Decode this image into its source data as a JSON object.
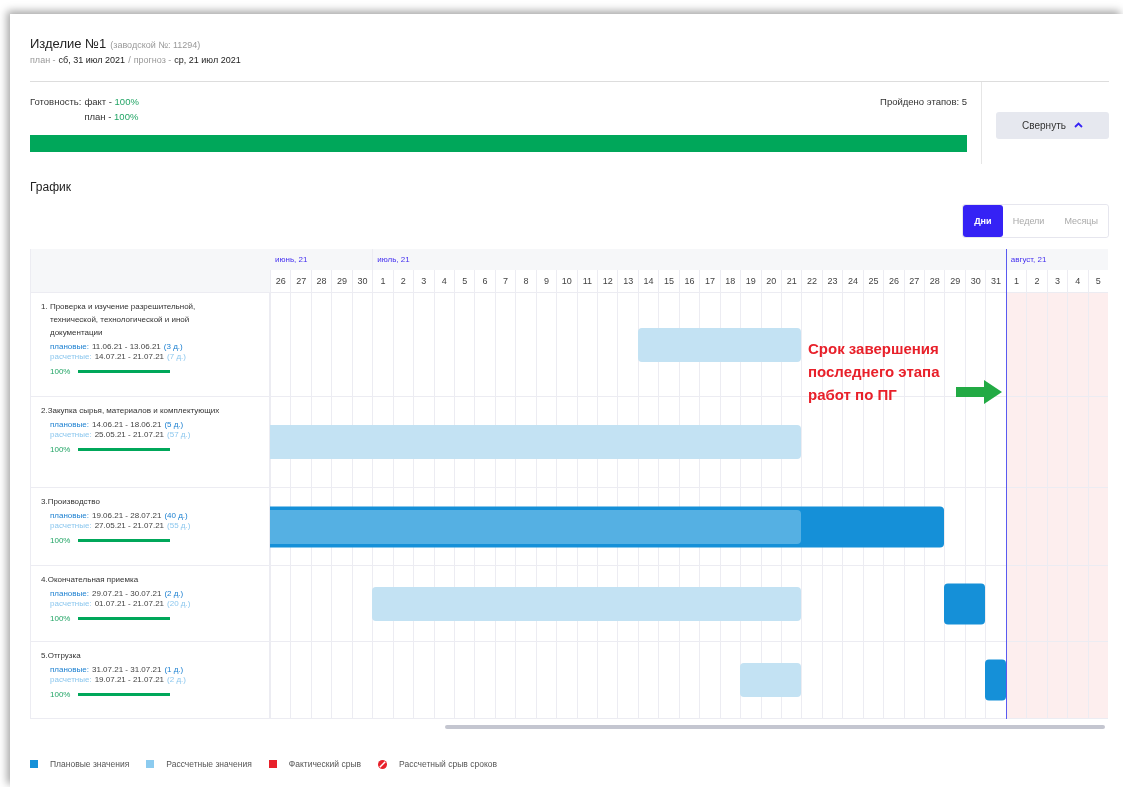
{
  "product": {
    "title": "Изделие №1",
    "serial": "(заводской №: 11294)",
    "plan_label": "план -",
    "plan_date": "сб, 31 июл 2021",
    "separator": "/",
    "forecast_label": "прогноз -",
    "forecast_date": "ср, 21 июл 2021"
  },
  "readiness": {
    "label": "Готовность:",
    "fact_label": "факт -",
    "fact_value": "100%",
    "plan_label": "план -",
    "plan_value": "100%",
    "level": 1,
    "stages_passed": "Пройдено этапов: 5"
  },
  "collapse_button": {
    "label": "Свернуть"
  },
  "schedule_title": "График",
  "tabs": [
    {
      "label": "Дни",
      "selected": true
    },
    {
      "label": "Недели",
      "selected": false
    },
    {
      "label": "Месяцы",
      "selected": false
    }
  ],
  "months": [
    {
      "label": "июнь, 21",
      "overdue": false,
      "days": [
        "26",
        "27",
        "28",
        "29",
        "30"
      ]
    },
    {
      "label": "июль, 21",
      "overdue": false,
      "days": [
        "1",
        "2",
        "3",
        "4",
        "5",
        "6",
        "7",
        "8",
        "9",
        "10",
        "11",
        "12",
        "13",
        "14",
        "15",
        "16",
        "17",
        "18",
        "19",
        "20",
        "21",
        "22",
        "23",
        "24",
        "25",
        "26",
        "27",
        "28",
        "29",
        "30",
        "31"
      ]
    },
    {
      "label": "август, 21",
      "overdue": true,
      "days": [
        "1",
        "2",
        "3",
        "4",
        "5"
      ]
    }
  ],
  "stages": [
    {
      "name": "1. Проверка и изучение разрешительной, технической, технологической и иной документации",
      "planned": {
        "label": "плановые:",
        "dates": "11.06.21 - 13.06.21",
        "duration": "(3 д.)"
      },
      "calculated": {
        "label": "расчетные:",
        "dates": "14.07.21 - 21.07.21",
        "duration": "(7 д.)"
      },
      "progress": "100%",
      "level": 1
    },
    {
      "name": "2.Закупка сырья, материалов и комплектующих",
      "planned": {
        "label": "плановые:",
        "dates": "14.06.21 - 18.06.21",
        "duration": "(5 д.)"
      },
      "calculated": {
        "label": "расчетные:",
        "dates": "25.05.21 - 21.07.21",
        "duration": "(57 д.)"
      },
      "progress": "100%",
      "level": 1
    },
    {
      "name": "3.Производство",
      "planned": {
        "label": "плановые:",
        "dates": "19.06.21 - 28.07.21",
        "duration": "(40 д.)"
      },
      "calculated": {
        "label": "расчетные:",
        "dates": "27.05.21 - 21.07.21",
        "duration": "(55 д.)"
      },
      "progress": "100%",
      "level": 1
    },
    {
      "name": "4.Окончательная приемка",
      "planned": {
        "label": "плановые:",
        "dates": "29.07.21 - 30.07.21",
        "duration": "(2 д.)"
      },
      "calculated": {
        "label": "расчетные:",
        "dates": "01.07.21 - 21.07.21",
        "duration": "(20 д.)"
      },
      "progress": "100%",
      "level": 1
    },
    {
      "name": "5.Отгрузка",
      "planned": {
        "label": "плановые:",
        "dates": "31.07.21 - 31.07.21",
        "duration": "(1 д.)"
      },
      "calculated": {
        "label": "расчетные:",
        "dates": "19.07.21 - 21.07.21",
        "duration": "(2 д.)"
      },
      "progress": "100%",
      "level": 1
    }
  ],
  "annotation": "Срок завершения последнего этапа работ по ПГ",
  "legend": [
    {
      "kind": "planned",
      "label": "Плановые значения"
    },
    {
      "kind": "calculated",
      "label": "Рассчетные значения"
    },
    {
      "kind": "actual_delay",
      "label": "Фактический срыв"
    },
    {
      "kind": "calc_delay",
      "label": "Рассчетный срыв сроков"
    }
  ]
}
